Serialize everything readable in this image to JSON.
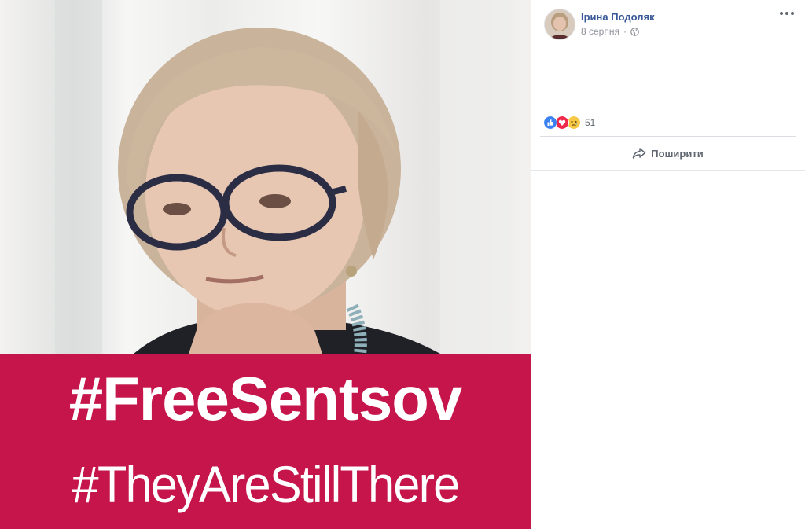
{
  "image": {
    "hashtag_1": "#FreeSentsov",
    "hashtag_2": "#TheyAreStillThere"
  },
  "post": {
    "author": "Ірина Подоляк",
    "date": "8 серпня",
    "separator": "·",
    "privacy_icon": "globe-icon",
    "options_icon": "more-options-icon",
    "reactions": [
      "like",
      "love",
      "sad"
    ],
    "reaction_count": "51",
    "share_label": "Поширити"
  },
  "colors": {
    "banner": "#c5154b",
    "link": "#385898",
    "meta": "#90949c"
  }
}
